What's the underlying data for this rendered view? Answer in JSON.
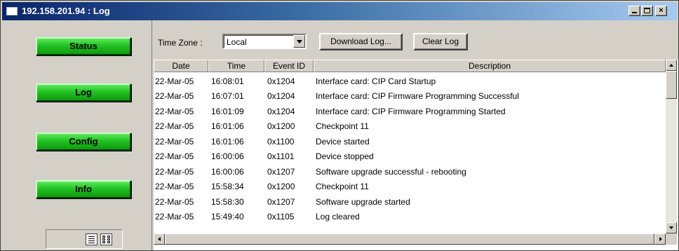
{
  "window": {
    "title": "192.158.201.94 : Log",
    "controls": {
      "minimize": "minimize-icon",
      "maximize": "maximize-icon",
      "close": "×"
    }
  },
  "nav": {
    "items": [
      {
        "label": "Status"
      },
      {
        "label": "Log"
      },
      {
        "label": "Config"
      },
      {
        "label": "Info"
      }
    ],
    "button_color": "#22c322",
    "view_icons": [
      "list-view-icon",
      "grid-view-icon"
    ]
  },
  "toolbar": {
    "timezone_label": "Time Zone :",
    "timezone_value": "Local",
    "download_label": "Download Log...",
    "clear_label": "Clear Log"
  },
  "log": {
    "columns": [
      "Date",
      "Time",
      "Event ID",
      "Description"
    ],
    "rows": [
      {
        "date": "22-Mar-05",
        "time": "16:08:01",
        "event_id": "0x1204",
        "description": "Interface card: CIP Card Startup"
      },
      {
        "date": "22-Mar-05",
        "time": "16:07:01",
        "event_id": "0x1204",
        "description": "Interface card: CIP Firmware Programming Successful"
      },
      {
        "date": "22-Mar-05",
        "time": "16:01:09",
        "event_id": "0x1204",
        "description": "Interface card: CIP Firmware Programming Started"
      },
      {
        "date": "22-Mar-05",
        "time": "16:01:06",
        "event_id": "0x1200",
        "description": "Checkpoint 11"
      },
      {
        "date": "22-Mar-05",
        "time": "16:01:06",
        "event_id": "0x1100",
        "description": "Device started"
      },
      {
        "date": "22-Mar-05",
        "time": "16:00:06",
        "event_id": "0x1101",
        "description": "Device stopped"
      },
      {
        "date": "22-Mar-05",
        "time": "16:00:06",
        "event_id": "0x1207",
        "description": "Software upgrade successful - rebooting"
      },
      {
        "date": "22-Mar-05",
        "time": "15:58:34",
        "event_id": "0x1200",
        "description": "Checkpoint 11"
      },
      {
        "date": "22-Mar-05",
        "time": "15:58:30",
        "event_id": "0x1207",
        "description": "Software upgrade started"
      },
      {
        "date": "22-Mar-05",
        "time": "15:49:40",
        "event_id": "0x1105",
        "description": "Log cleared"
      }
    ]
  },
  "colors": {
    "title_bar_start": "#0a246a",
    "title_bar_end": "#a6caf0",
    "panel_bg": "#d4d0c8"
  }
}
